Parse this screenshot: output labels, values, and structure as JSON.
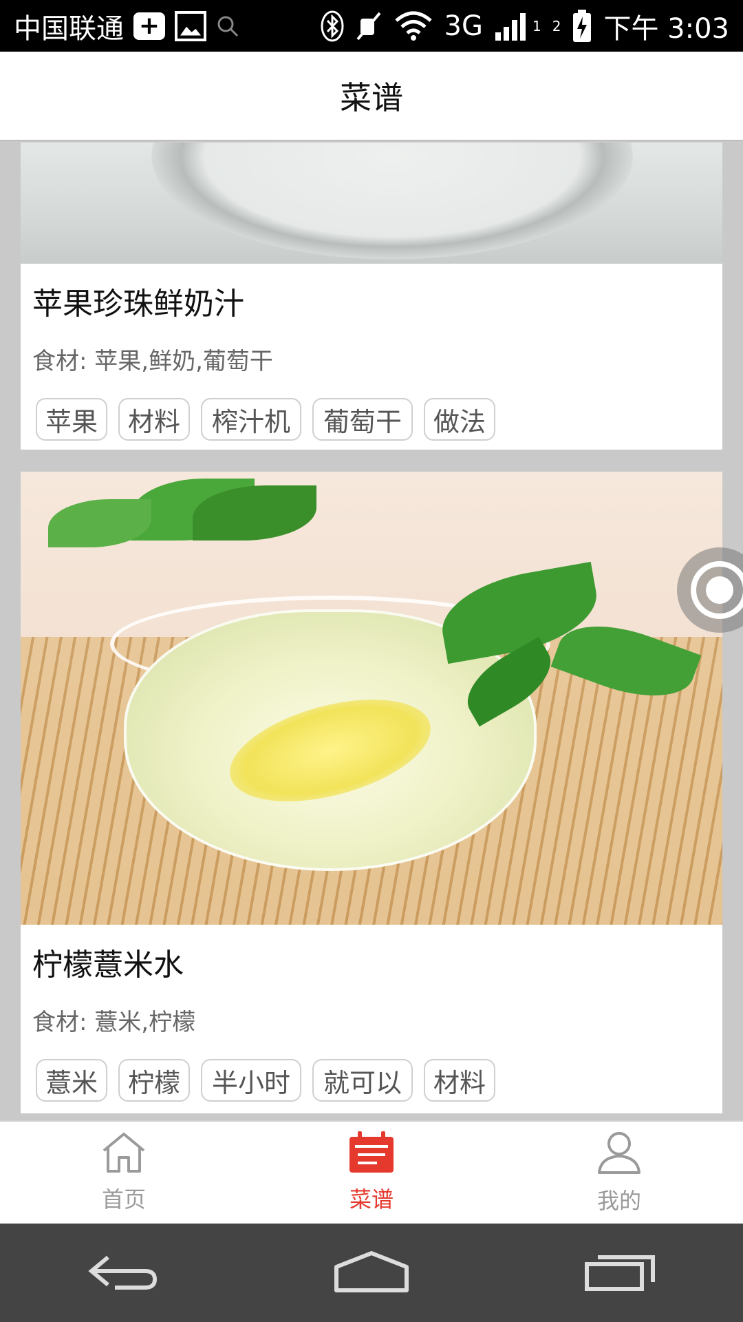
{
  "status_bar": {
    "carrier": "中国联通",
    "network": "3G",
    "sim1": "1",
    "sim2": "2",
    "time": "下午 3:03",
    "icons": [
      "plus-icon",
      "image-icon",
      "search-icon",
      "bluetooth-icon",
      "mute-icon",
      "wifi-icon",
      "signal-icon",
      "battery-icon"
    ]
  },
  "header": {
    "title": "菜谱"
  },
  "recipes": [
    {
      "title": "苹果珍珠鲜奶汁",
      "ingredients": "食材: 苹果,鲜奶,葡萄干",
      "tags": [
        "苹果",
        "材料",
        "榨汁机",
        "葡萄干",
        "做法"
      ]
    },
    {
      "title": "柠檬薏米水",
      "ingredients": "食材: 薏米,柠檬",
      "tags": [
        "薏米",
        "柠檬",
        "半小时",
        "就可以",
        "材料"
      ]
    }
  ],
  "tabbar": {
    "items": [
      {
        "label": "首页",
        "icon": "home-icon",
        "active": false
      },
      {
        "label": "菜谱",
        "icon": "calendar-icon",
        "active": true
      },
      {
        "label": "我的",
        "icon": "user-icon",
        "active": false
      }
    ],
    "active_color": "#e5392e",
    "inactive_color": "#9a9a9a"
  },
  "nav": {
    "icons": [
      "back-icon",
      "home-nav-icon",
      "recents-icon"
    ]
  }
}
